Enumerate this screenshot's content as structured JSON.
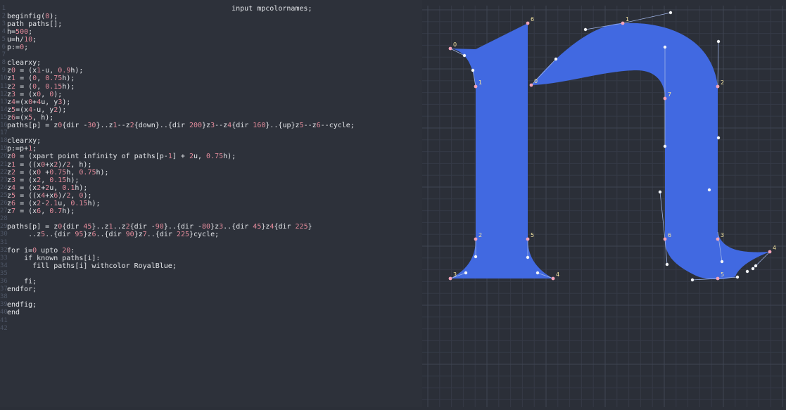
{
  "editor": {
    "language": "MetaPost",
    "lines": [
      {
        "n": "1",
        "text": "                                                     input mpcolornames;"
      },
      {
        "n": "2",
        "text": "beginfig(0);"
      },
      {
        "n": "3",
        "text": "path paths[];"
      },
      {
        "n": "4",
        "text": "h=500;"
      },
      {
        "n": "5",
        "text": "u=h/10;"
      },
      {
        "n": "6",
        "text": "p:=0;"
      },
      {
        "n": "7",
        "text": ""
      },
      {
        "n": "8",
        "text": "clearxy;"
      },
      {
        "n": "9",
        "text": "z0 = (x1-u, 0.9h);"
      },
      {
        "n": "10",
        "text": "z1 = (0, 0.75h);"
      },
      {
        "n": "11",
        "text": "z2 = (0, 0.15h);"
      },
      {
        "n": "12",
        "text": "z3 = (x0, 0);"
      },
      {
        "n": "13",
        "text": "z4=(x0+4u, y3);"
      },
      {
        "n": "14",
        "text": "z5=(x4-u, y2);"
      },
      {
        "n": "15",
        "text": "z6=(x5, h);"
      },
      {
        "n": "16",
        "text": "paths[p] = z0{dir -30}..z1--z2{down}..{dir 200}z3--z4{dir 160}..{up}z5--z6--cycle;"
      },
      {
        "n": "17",
        "text": ""
      },
      {
        "n": "18",
        "text": "clearxy;"
      },
      {
        "n": "19",
        "text": "p:=p+1;"
      },
      {
        "n": "20",
        "text": "z0 = (xpart point infinity of paths[p-1] + 2u, 0.75h);"
      },
      {
        "n": "21",
        "text": "z1 = ((x0+x2)/2, h);"
      },
      {
        "n": "22",
        "text": "z2 = (x0 +0.75h, 0.75h);"
      },
      {
        "n": "23",
        "text": "z3 = (x2, 0.15h);"
      },
      {
        "n": "24",
        "text": "z4 = (x2+2u, 0.1h);"
      },
      {
        "n": "25",
        "text": "z5 = ((x4+x6)/2, 0);"
      },
      {
        "n": "26",
        "text": "z6 = (x2-2.1u, 0.15h);"
      },
      {
        "n": "27",
        "text": "z7 = (x6, 0.7h);"
      },
      {
        "n": "28",
        "text": ""
      },
      {
        "n": "29",
        "text": "paths[p] = z0{dir 45}..z1..z2{dir -90}..{dir -80}z3..{dir 45}z4{dir 225}"
      },
      {
        "n": "30",
        "text": "     ..z5..{dir 95}z6..{dir 90}z7..{dir 225}cycle;"
      },
      {
        "n": "31",
        "text": ""
      },
      {
        "n": "32",
        "text": "for i=0 upto 20:"
      },
      {
        "n": "33",
        "text": "    if known paths[i]:"
      },
      {
        "n": "34",
        "text": "      fill paths[i] withcolor RoyalBlue;"
      },
      {
        "n": "35",
        "text": ""
      },
      {
        "n": "36",
        "text": "    fi;"
      },
      {
        "n": "37",
        "text": "endfor;"
      },
      {
        "n": "38",
        "text": ""
      },
      {
        "n": "39",
        "text": "endfig;"
      },
      {
        "n": "40",
        "text": "end"
      },
      {
        "n": "41",
        "text": ""
      },
      {
        "n": "42",
        "text": ""
      }
    ]
  },
  "preview": {
    "fill_color": "#4169e1",
    "point_labels_path0": [
      "0",
      "1",
      "2",
      "3",
      "4",
      "5",
      "6"
    ],
    "point_labels_path1": [
      "0",
      "1",
      "2",
      "3",
      "4",
      "5",
      "6",
      "7"
    ]
  },
  "colors": {
    "editor_bg": "#2d313a",
    "text": "#e4e6ea",
    "number": "#e58c9c",
    "line_number": "#4d5565",
    "glyph_fill": "#4169e1"
  }
}
